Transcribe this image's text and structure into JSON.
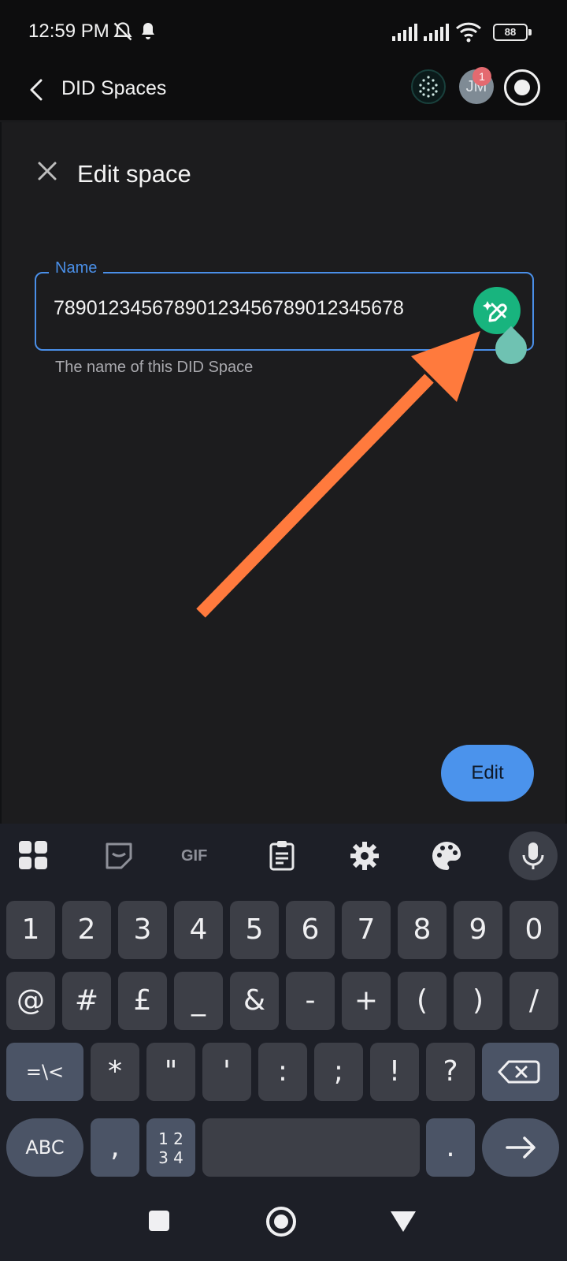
{
  "status_bar": {
    "time": "12:59 PM",
    "battery": "88"
  },
  "header": {
    "title": "DID Spaces",
    "avatar_initials": "JM",
    "notification_count": "1"
  },
  "dialog": {
    "title": "Edit space",
    "field_label": "Name",
    "field_value": "78901234567890123456789012345678",
    "helper_text": "The name of this DID Space",
    "edit_label": "Edit"
  },
  "keyboard": {
    "tools": [
      "apps-grid-icon",
      "sticker-icon",
      "GIF",
      "clipboard-icon",
      "settings-icon",
      "palette-icon",
      "mic-icon"
    ],
    "gif_label": "GIF",
    "row1": [
      "1",
      "2",
      "3",
      "4",
      "5",
      "6",
      "7",
      "8",
      "9",
      "0"
    ],
    "row2": [
      "@",
      "#",
      "£",
      "_",
      "&",
      "-",
      "+",
      "(",
      ")",
      "/"
    ],
    "row3_toggle": "=\\<",
    "row3": [
      "*",
      "\"",
      "'",
      ":",
      ";",
      "!",
      "?"
    ],
    "abc": "ABC",
    "comma": ",",
    "numpad_label": "1 2\n3 4",
    "period": "."
  },
  "annotation": {
    "arrow_color": "#ff7a3d"
  },
  "colors": {
    "accent": "#4a8fe8",
    "ai_button": "#18b47e",
    "background": "#1c1c1e"
  }
}
